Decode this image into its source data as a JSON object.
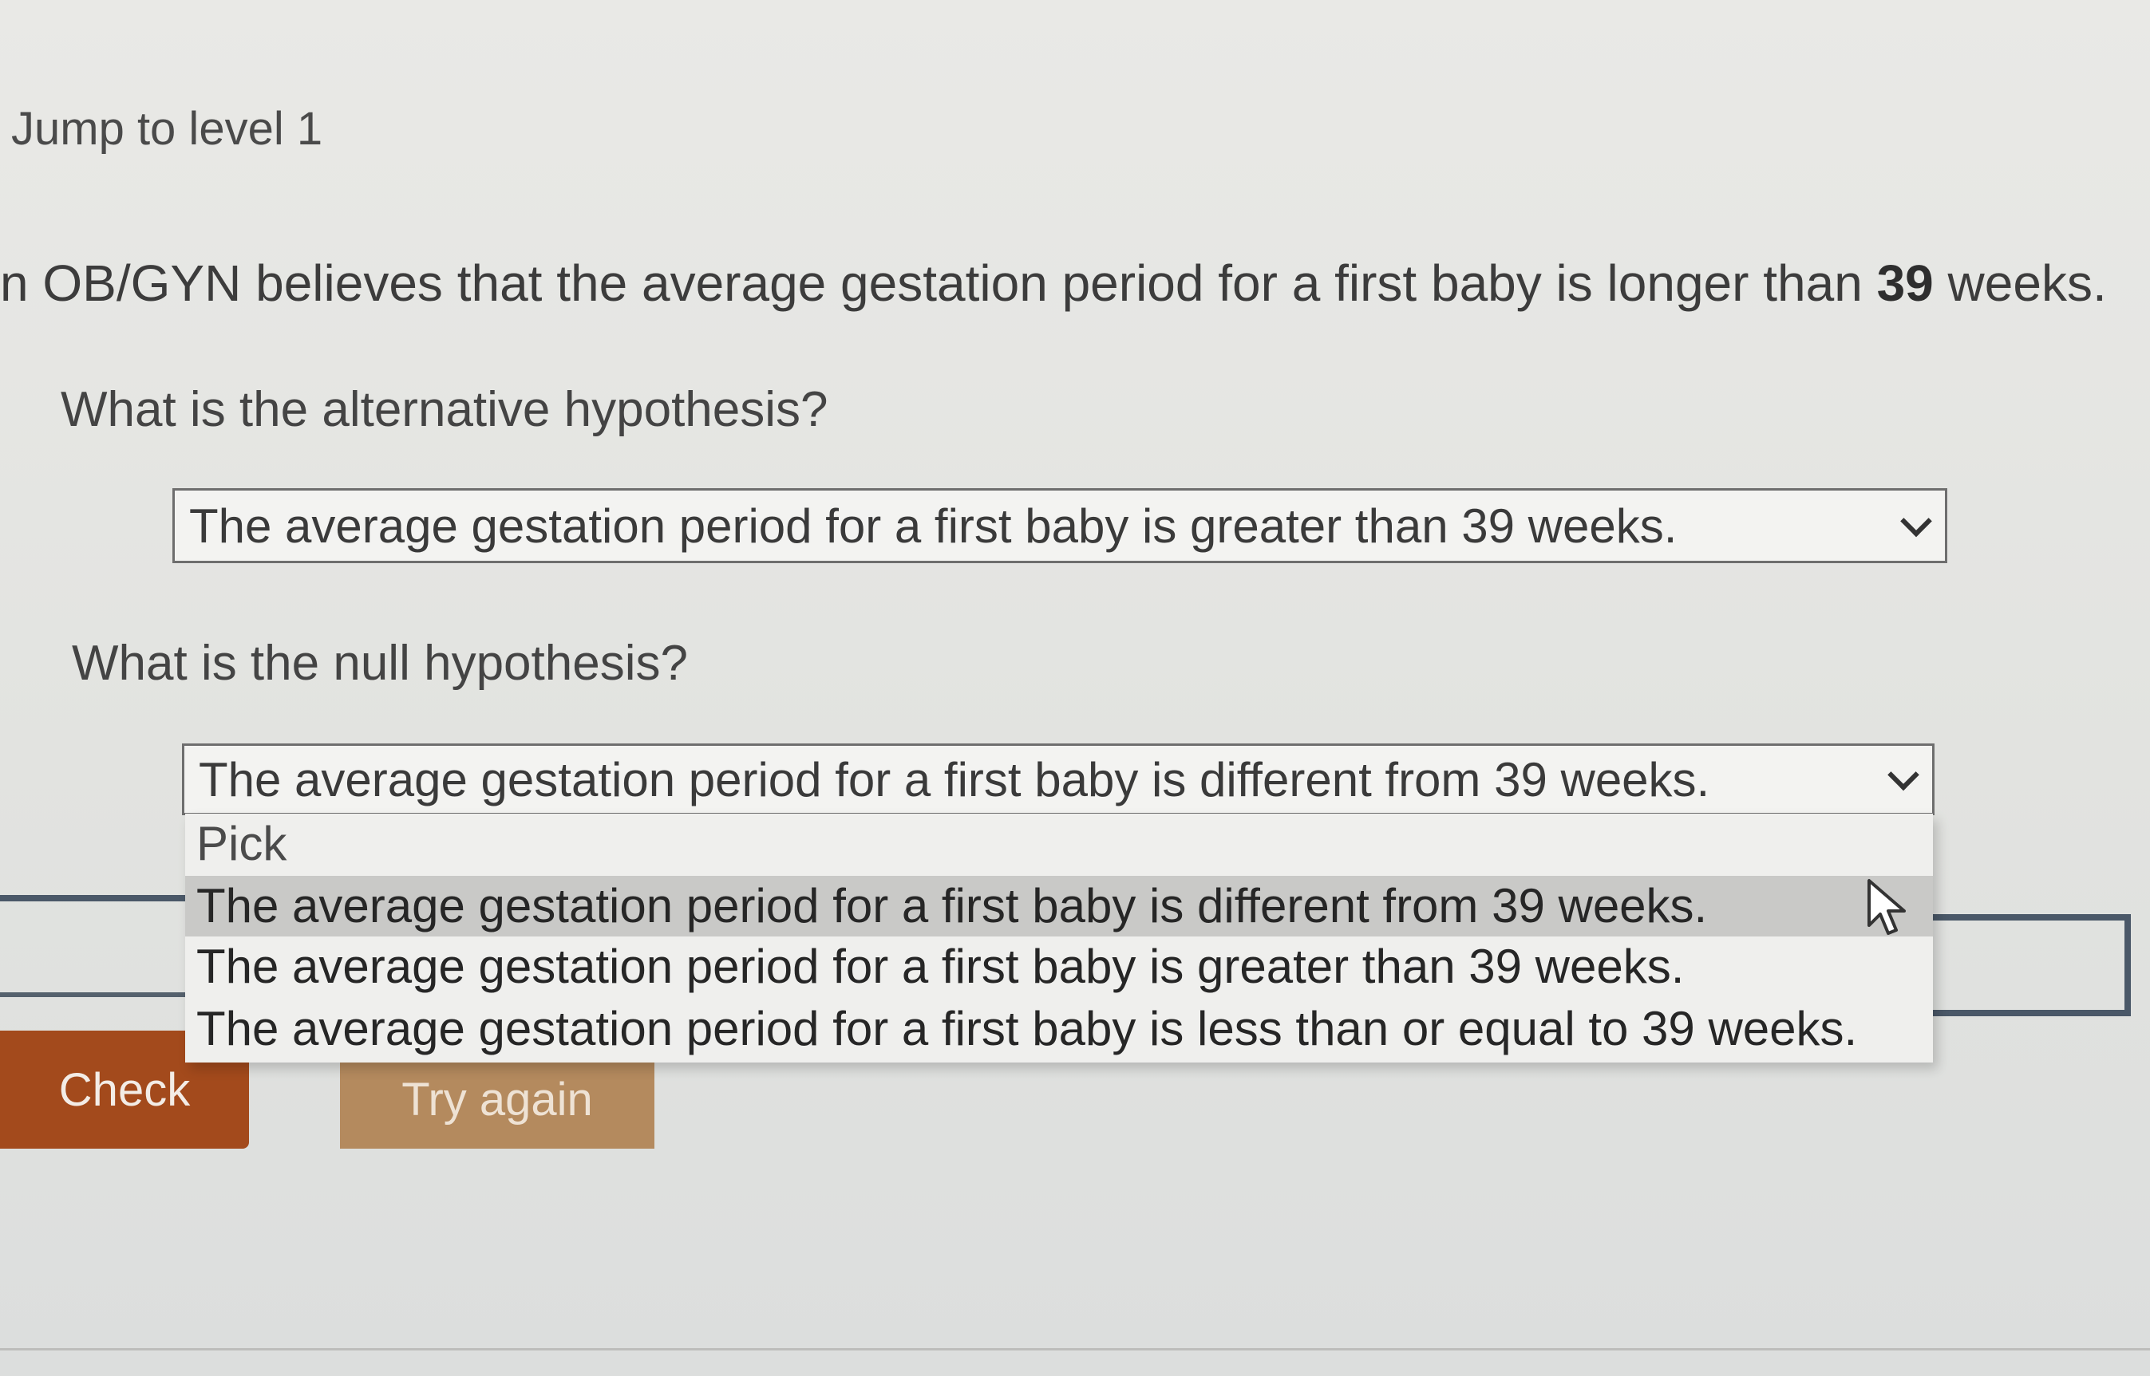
{
  "nav": {
    "jump_link": "Jump to level 1"
  },
  "problem": {
    "statement_before": "n OB/GYN believes that the average gestation period for a first baby is longer than ",
    "statement_number": "39",
    "statement_after": " weeks."
  },
  "alternative": {
    "question": "What is the alternative hypothesis?",
    "selected": "The average gestation period for a first baby is greater than 39 weeks."
  },
  "null": {
    "question": "What is the null hypothesis?",
    "selected": "The average gestation period for a first baby is different from 39 weeks.",
    "options": [
      "Pick",
      "The average gestation period for a first baby is different from 39 weeks.",
      "The average gestation period for a first baby is greater than 39 weeks.",
      "The average gestation period for a first baby is less than or equal to 39 weeks."
    ]
  },
  "buttons": {
    "check": "Check",
    "try_again": "Try again"
  },
  "icons": {
    "dropdown": "chevron-down-icon",
    "cursor": "mouse-pointer-icon"
  },
  "colors": {
    "check_button": "#a34a1c",
    "try_again_button": "#b48a5e",
    "highlighted_option": "#c9c9c7"
  }
}
